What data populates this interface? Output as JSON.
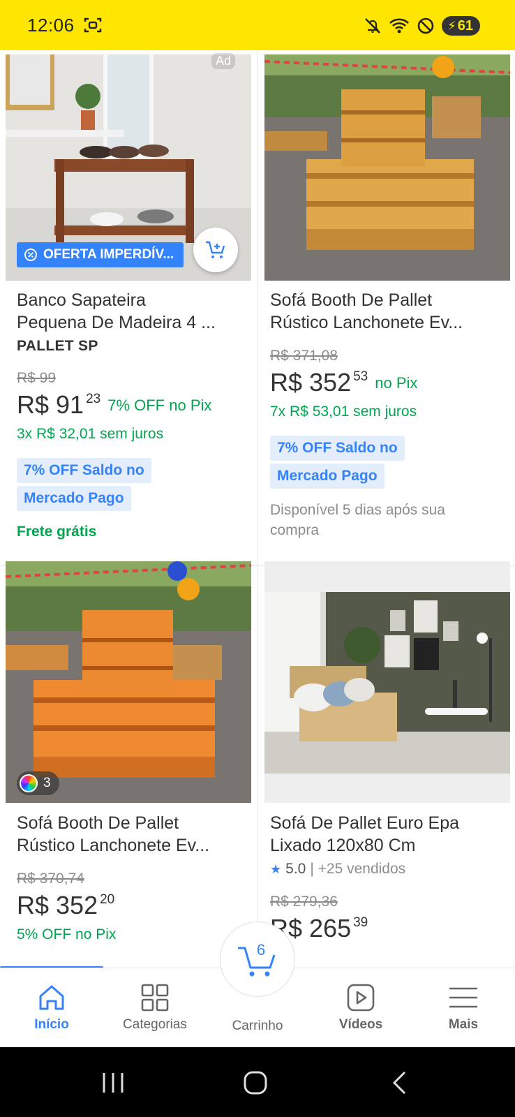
{
  "status_bar": {
    "time": "12:06",
    "battery": "61",
    "bg_color": "#ffe600"
  },
  "products": [
    {
      "title_line1": "Banco Sapateira",
      "title_line2": "Pequena De Madeira 4 ...",
      "brand": "PALLET SP",
      "ad_label": "Ad",
      "offer_badge": "OFERTA IMPERDÍV...",
      "old_price": "R$ 99",
      "price_main": "R$ 91",
      "price_cents": "23",
      "pix_text": "7% OFF no Pix",
      "installments": "3x R$ 32,01 sem juros",
      "tag_line1": "7% OFF Saldo no",
      "tag_line2": "Mercado Pago",
      "shipping": "Frete grátis"
    },
    {
      "title_line1": "Sofá Booth De Pallet",
      "title_line2": "Rústico Lanchonete Ev...",
      "old_price": "R$ 371,08",
      "price_main": "R$ 352",
      "price_cents": "53",
      "pix_text": "no Pix",
      "installments": "7x R$ 53,01 sem juros",
      "tag_line1": "7% OFF Saldo no",
      "tag_line2": "Mercado Pago",
      "availability": "Disponível 5 dias após sua compra"
    },
    {
      "title_line1": "Sofá Booth De Pallet",
      "title_line2": "Rústico Lanchonete Ev...",
      "color_count": "3",
      "old_price": "R$ 370,74",
      "price_main": "R$ 352",
      "price_cents": "20",
      "pix_text": "5% OFF no Pix"
    },
    {
      "title_line1": "Sofá De Pallet Euro Epa",
      "title_line2": "Lixado 120x80 Cm",
      "rating": "5.0",
      "sold": "| +25 vendidos",
      "old_price": "R$ 279,36",
      "price_main": "R$ 265",
      "price_cents": "39"
    }
  ],
  "bottom_nav": {
    "items": [
      {
        "label": "Início",
        "icon": "home-icon"
      },
      {
        "label": "Categorias",
        "icon": "grid-icon"
      },
      {
        "label": "Carrinho",
        "icon": "cart-icon",
        "badge": "6"
      },
      {
        "label": "Vídeos",
        "icon": "play-icon"
      },
      {
        "label": "Mais",
        "icon": "menu-icon"
      }
    ],
    "accent": "#3483fa"
  }
}
